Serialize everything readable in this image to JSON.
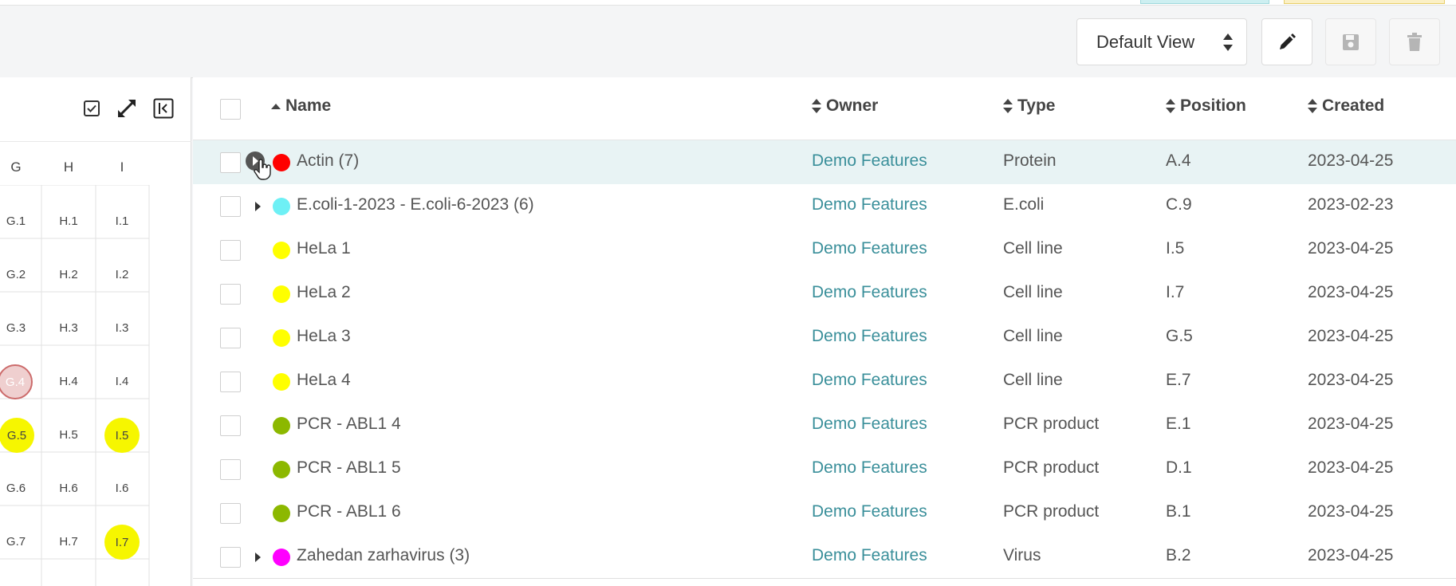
{
  "toolbar": {
    "view_select": "Default View",
    "edit_icon": "pencil-icon",
    "save_icon": "save-icon",
    "delete_icon": "trash-icon"
  },
  "plate": {
    "tools": [
      "select-all-icon",
      "expand-icon",
      "collapse-panel-icon"
    ],
    "columns": [
      "G",
      "H",
      "I"
    ],
    "rows": [
      [
        "G.1",
        "H.1",
        "I.1"
      ],
      [
        "G.2",
        "H.2",
        "I.2"
      ],
      [
        "G.3",
        "H.3",
        "I.3"
      ],
      [
        "G.4",
        "H.4",
        "I.4"
      ],
      [
        "G.5",
        "H.5",
        "I.5"
      ],
      [
        "G.6",
        "H.6",
        "I.6"
      ],
      [
        "G.7",
        "H.7",
        "I.7"
      ]
    ]
  },
  "table": {
    "headers": {
      "name": "Name",
      "owner": "Owner",
      "type": "Type",
      "position": "Position",
      "created": "Created"
    },
    "rows": [
      {
        "name": "Actin (7)",
        "owner": "Demo Features",
        "type": "Protein",
        "position": "A.4",
        "created": "2023-04-25",
        "color": "#ff0000"
      },
      {
        "name": "E.coli-1-2023 - E.coli-6-2023 (6)",
        "owner": "Demo Features",
        "type": "E.coli",
        "position": "C.9",
        "created": "2023-02-23",
        "color": "#6ef0f5"
      },
      {
        "name": "HeLa 1",
        "owner": "Demo Features",
        "type": "Cell line",
        "position": "I.5",
        "created": "2023-04-25",
        "color": "#ffff00"
      },
      {
        "name": "HeLa 2",
        "owner": "Demo Features",
        "type": "Cell line",
        "position": "I.7",
        "created": "2023-04-25",
        "color": "#ffff00"
      },
      {
        "name": "HeLa 3",
        "owner": "Demo Features",
        "type": "Cell line",
        "position": "G.5",
        "created": "2023-04-25",
        "color": "#ffff00"
      },
      {
        "name": "HeLa 4",
        "owner": "Demo Features",
        "type": "Cell line",
        "position": "E.7",
        "created": "2023-04-25",
        "color": "#ffff00"
      },
      {
        "name": "PCR - ABL1 4",
        "owner": "Demo Features",
        "type": "PCR product",
        "position": "E.1",
        "created": "2023-04-25",
        "color": "#8cb800"
      },
      {
        "name": "PCR - ABL1 5",
        "owner": "Demo Features",
        "type": "PCR product",
        "position": "D.1",
        "created": "2023-04-25",
        "color": "#8cb800"
      },
      {
        "name": "PCR - ABL1 6",
        "owner": "Demo Features",
        "type": "PCR product",
        "position": "B.1",
        "created": "2023-04-25",
        "color": "#8cb800"
      },
      {
        "name": "Zahedan zarhavirus (3)",
        "owner": "Demo Features",
        "type": "Virus",
        "position": "B.2",
        "created": "2023-04-25",
        "color": "#ff00ff"
      }
    ]
  }
}
